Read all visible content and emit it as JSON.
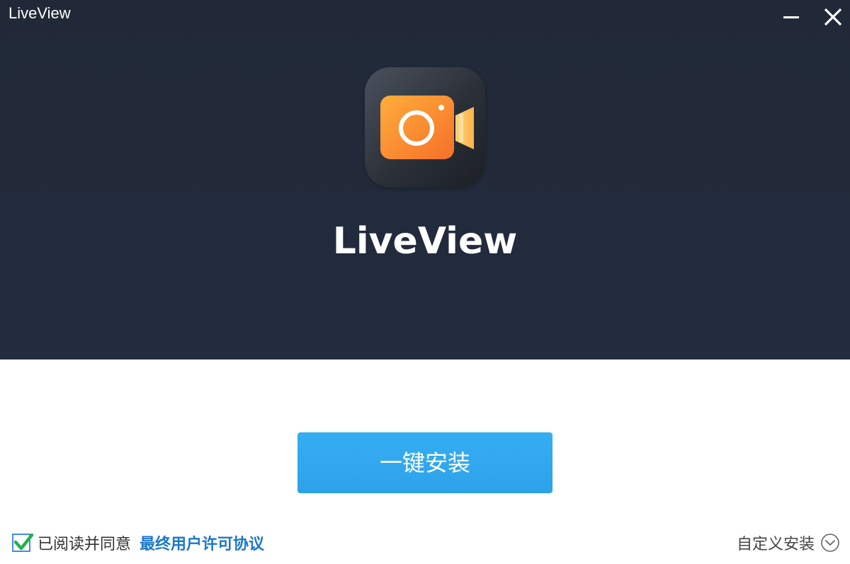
{
  "window": {
    "title": "LiveView"
  },
  "banner": {
    "app_name": "LiveView",
    "icon": "video-camera-icon",
    "colors": {
      "background": "#222a3a",
      "icon_orange": "#f7932a"
    }
  },
  "install": {
    "button_label": "一键安装",
    "color": "#33aaf0"
  },
  "footer": {
    "agree_checked": true,
    "agree_text": "已阅读并同意",
    "eula_link": "最终用户许可协议",
    "custom_install": "自定义安装"
  }
}
